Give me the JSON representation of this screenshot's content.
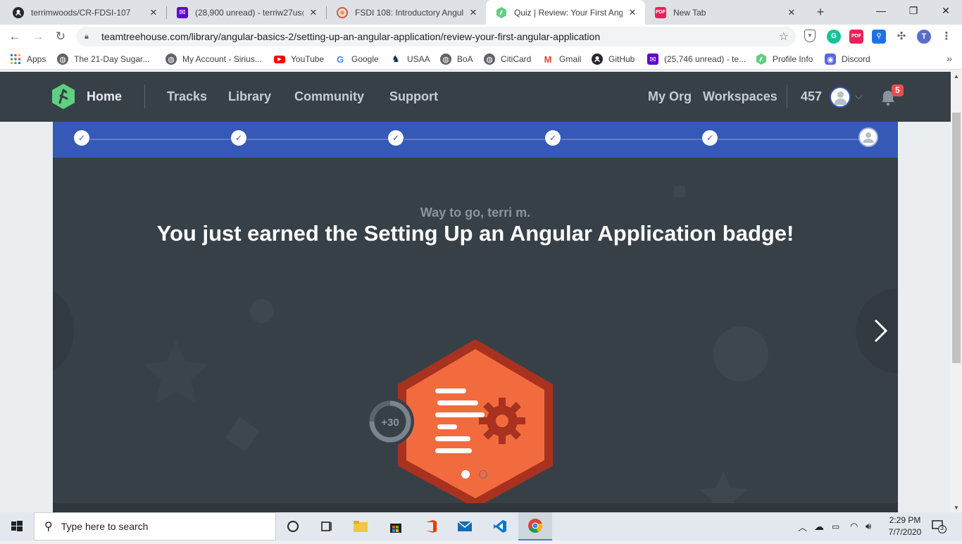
{
  "browser": {
    "tabs": [
      {
        "title": "terrimwoods/CR-FDSI-107",
        "icon": "github-icon"
      },
      {
        "title": "(28,900 unread) - terriw27us@",
        "icon": "yahoo-mail-icon"
      },
      {
        "title": "FSDI 108: Introductory Angular",
        "icon": "course-icon"
      },
      {
        "title": "Quiz | Review: Your First Angul",
        "icon": "treehouse-icon",
        "active": true
      },
      {
        "title": "New Tab",
        "icon": "pdf-icon"
      }
    ],
    "url": "teamtreehouse.com/library/angular-basics-2/setting-up-an-angular-application/review-your-first-angular-application",
    "profile_initial": "T",
    "bookmarks": [
      {
        "label": "Apps",
        "icon": "apps-grid-icon"
      },
      {
        "label": "The 21-Day Sugar...",
        "icon": "globe-icon"
      },
      {
        "label": "My Account - Sirius...",
        "icon": "globe-icon"
      },
      {
        "label": "YouTube",
        "icon": "youtube-icon"
      },
      {
        "label": "Google",
        "icon": "google-icon"
      },
      {
        "label": "USAA",
        "icon": "usaa-icon"
      },
      {
        "label": "BoA",
        "icon": "globe-icon"
      },
      {
        "label": "CitiCard",
        "icon": "globe-icon"
      },
      {
        "label": "Gmail",
        "icon": "gmail-icon"
      },
      {
        "label": "GitHub",
        "icon": "github-icon"
      },
      {
        "label": "(25,746 unread) - te...",
        "icon": "yahoo-mail-icon"
      },
      {
        "label": "Profile Info",
        "icon": "treehouse-icon"
      },
      {
        "label": "Discord",
        "icon": "discord-icon"
      }
    ]
  },
  "site": {
    "nav": {
      "home": "Home",
      "tracks": "Tracks",
      "library": "Library",
      "community": "Community",
      "support": "Support",
      "my_org": "My Org",
      "workspaces": "Workspaces"
    },
    "points": "457",
    "notifications": "5",
    "steps_completed": 5,
    "steps_total": 6
  },
  "achievement": {
    "greeting": "Way to go, terri m.",
    "headline": "You just earned the Setting Up an Angular Application badge!",
    "points_awarded": "+30",
    "slide_current": 1,
    "slide_total": 2
  },
  "colors": {
    "header_bg": "#384047",
    "progress_blue": "#3659b7",
    "badge_orange": "#f26b3e",
    "badge_border": "#a8321f",
    "treehouse_green": "#5fcf80"
  },
  "taskbar": {
    "search_placeholder": "Type here to search",
    "time": "2:29 PM",
    "date": "7/7/2020",
    "notification_count": "3"
  }
}
